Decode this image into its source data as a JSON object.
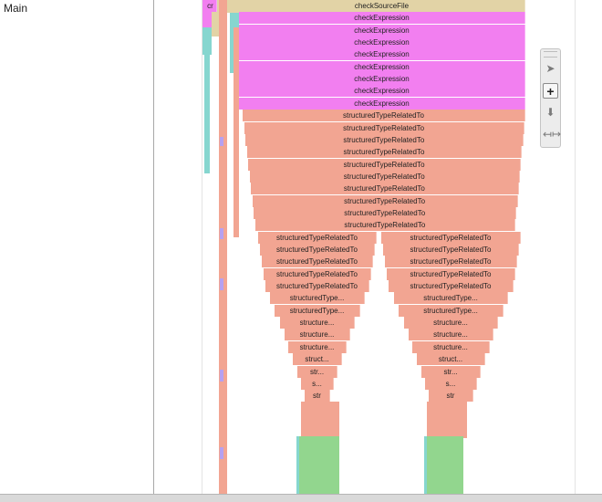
{
  "track": {
    "label": "Main"
  },
  "colors": {
    "root": "#e2d3a6",
    "expression": "#f27ff0",
    "typeRelated": "#f2a592",
    "teal": "#86d6cf",
    "green": "#92d68e",
    "purple": "#b6a0f0"
  },
  "flame": {
    "root": "checkSourceFile",
    "root_short": "cr",
    "expressions": [
      "checkExpression",
      "checkExpression",
      "checkExpression",
      "checkExpression",
      "checkExpression",
      "checkExpression",
      "checkExpression",
      "checkExpression"
    ],
    "main_chain": [
      "structuredTypeRelatedTo",
      "structuredTypeRelatedTo",
      "structuredTypeRelatedTo",
      "structuredTypeRelatedTo",
      "structuredTypeRelatedTo",
      "structuredTypeRelatedTo",
      "structuredTypeRelatedTo",
      "structuredTypeRelatedTo",
      "structuredTypeRelatedTo",
      "structuredTypeRelatedTo"
    ],
    "left_branch": [
      "structuredTypeRelatedTo",
      "structuredTypeRelatedTo",
      "structuredTypeRelatedTo",
      "structuredTypeRelatedTo",
      "structuredTypeRelatedTo",
      "structuredType...",
      "structuredType...",
      "structure...",
      "structure...",
      "structure...",
      "struct...",
      "str...",
      "s...",
      "str"
    ],
    "right_branch": [
      "structuredTypeRelatedTo",
      "structuredTypeRelatedTo",
      "structuredTypeRelatedTo",
      "structuredTypeRelatedTo",
      "structuredTypeRelatedTo",
      "structuredType...",
      "structuredType...",
      "structure...",
      "structure...",
      "structure...",
      "struct...",
      "str...",
      "s...",
      "str"
    ]
  },
  "zoom_controls": {
    "select_icon": "cursor-arrow-icon",
    "zoom_in_icon": "zoom-in-icon",
    "pan_icon": "pan-down-icon",
    "fit_icon": "fit-width-icon",
    "active": "zoom-in"
  }
}
